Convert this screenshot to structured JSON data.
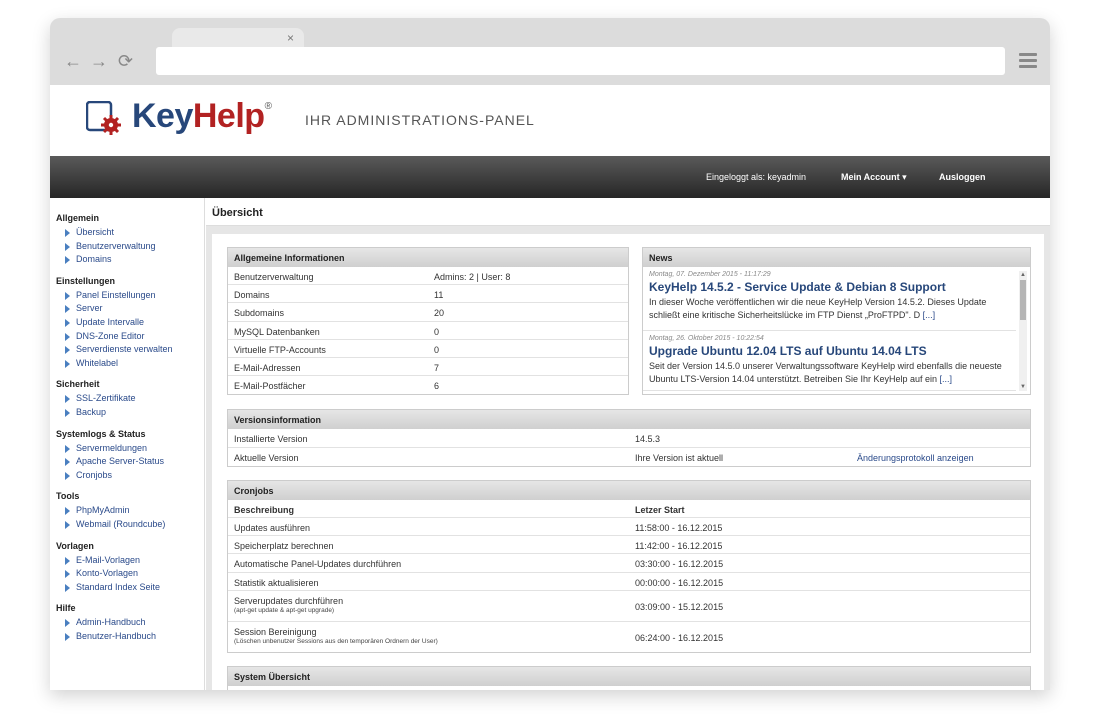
{
  "browser": {
    "tab_close": "×",
    "back": "←",
    "forward": "→",
    "reload": "⟳"
  },
  "brand": {
    "key": "Key",
    "help": "Help",
    "reg": "®",
    "tagline": "IHR ADMINISTRATIONS-PANEL",
    "accent": "#27477a",
    "accent_red": "#b22222"
  },
  "topbar": {
    "logged_in": "Eingeloggt als: keyadmin",
    "account": "Mein Account ▾",
    "logout": "Ausloggen"
  },
  "sidebar": [
    {
      "title": "Allgemein",
      "items": [
        "Übersicht",
        "Benutzerverwaltung",
        "Domains"
      ]
    },
    {
      "title": "Einstellungen",
      "items": [
        "Panel Einstellungen",
        "Server",
        "Update Intervalle",
        "DNS-Zone Editor",
        "Serverdienste verwalten",
        "Whitelabel"
      ]
    },
    {
      "title": "Sicherheit",
      "items": [
        "SSL-Zertifikate",
        "Backup"
      ]
    },
    {
      "title": "Systemlogs & Status",
      "items": [
        "Servermeldungen",
        "Apache Server-Status",
        "Cronjobs"
      ]
    },
    {
      "title": "Tools",
      "items": [
        "PhpMyAdmin",
        "Webmail (Roundcube)"
      ]
    },
    {
      "title": "Vorlagen",
      "items": [
        "E-Mail-Vorlagen",
        "Konto-Vorlagen",
        "Standard Index Seite"
      ]
    },
    {
      "title": "Hilfe",
      "items": [
        "Admin-Handbuch",
        "Benutzer-Handbuch"
      ]
    }
  ],
  "page_title": "Übersicht",
  "general": {
    "title": "Allgemeine Informationen",
    "rows": [
      {
        "label": "Benutzerverwaltung",
        "value": "Admins: 2 | User: 8"
      },
      {
        "label": "Domains",
        "value": "11"
      },
      {
        "label": "Subdomains",
        "value": "20"
      },
      {
        "label": "MySQL Datenbanken",
        "value": "0"
      },
      {
        "label": "Virtuelle FTP-Accounts",
        "value": "0"
      },
      {
        "label": "E-Mail-Adressen",
        "value": "7"
      },
      {
        "label": "E-Mail-Postfächer",
        "value": "6"
      }
    ]
  },
  "news": {
    "title": "News",
    "items": [
      {
        "date": "Montag, 07. Dezember 2015 - 11:17:29",
        "title": "KeyHelp 14.5.2 - Service Update & Debian 8 Support",
        "text": "In dieser Woche veröffentlichen wir die neue KeyHelp Version 14.5.2. Dieses Update schließt eine kritische Sicherheitslücke im FTP Dienst „ProFTPD\". D",
        "more": "[...]"
      },
      {
        "date": "Montag, 26. Oktober 2015 - 10:22:54",
        "title": "Upgrade Ubuntu 12.04 LTS auf Ubuntu 14.04 LTS",
        "text": "Seit der Version 14.5.0 unserer Verwaltungssoftware KeyHelp wird ebenfalls die neueste Ubuntu LTS-Version 14.04 unterstützt. Betreiben Sie Ihr KeyHelp auf ein",
        "more": "[...]"
      }
    ],
    "scroll_up": "▲",
    "scroll_down": "▼"
  },
  "version": {
    "title": "Versionsinformation",
    "installed_label": "Installierte Version",
    "installed_value": "14.5.3",
    "current_label": "Aktuelle Version",
    "current_value": "Ihre Version ist aktuell",
    "changelog_link": "Änderungsprotokoll anzeigen"
  },
  "cron": {
    "title": "Cronjobs",
    "col_desc": "Beschreibung",
    "col_start": "Letzer Start",
    "rows": [
      {
        "desc": "Updates ausführen",
        "sub": "",
        "start": "11:58:00 - 16.12.2015"
      },
      {
        "desc": "Speicherplatz berechnen",
        "sub": "",
        "start": "11:42:00 - 16.12.2015"
      },
      {
        "desc": "Automatische Panel-Updates durchführen",
        "sub": "",
        "start": "03:30:00 - 16.12.2015"
      },
      {
        "desc": "Statistik aktualisieren",
        "sub": "",
        "start": "00:00:00 - 16.12.2015"
      },
      {
        "desc": "Serverupdates durchführen",
        "sub": "(apt-get update & apt-get upgrade)",
        "start": "03:09:00 - 15.12.2015"
      },
      {
        "desc": "Session Bereinigung",
        "sub": "(Löschen unbenutzer Sessions aus den temporären Ordnern der User)",
        "start": "06:24:00 - 16.12.2015"
      }
    ]
  },
  "system": {
    "title": "System Übersicht"
  }
}
